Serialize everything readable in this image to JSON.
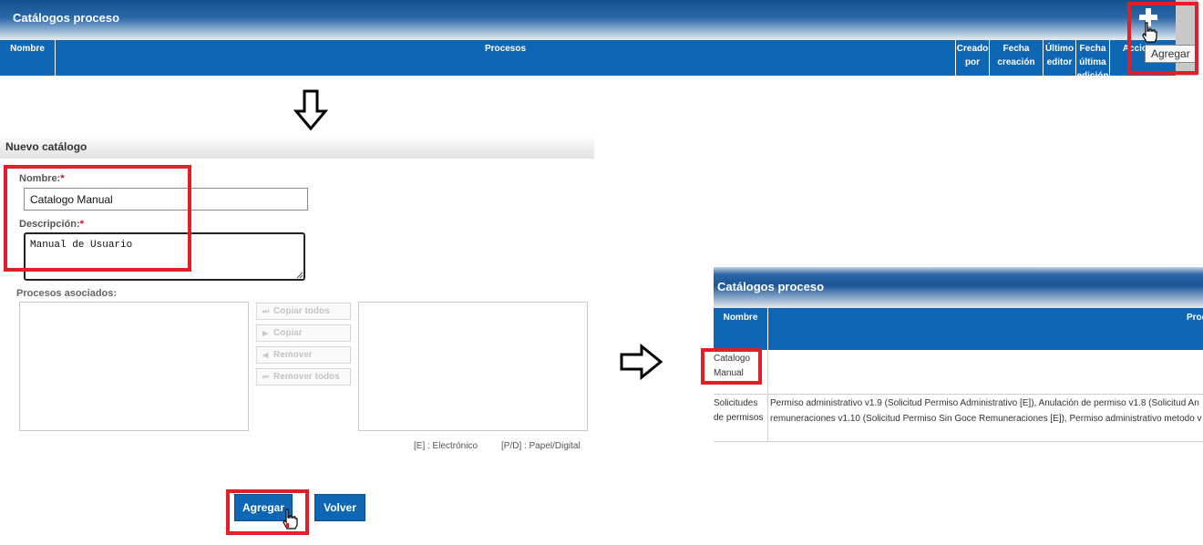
{
  "top_table": {
    "title": "Catálogos proceso",
    "columns": [
      "Nombre",
      "Procesos",
      "Creado por",
      "Fecha creación",
      "Último editor",
      "Fecha última edición",
      "Acciones"
    ],
    "tooltip": "Agregar"
  },
  "form": {
    "title": "Nuevo catálogo",
    "name_label": "Nombre:",
    "name_value": "Catalogo Manual",
    "desc_label": "Descripción:",
    "desc_value": "Manual de Usuario",
    "required_mark": "*",
    "processes_label": "Procesos asociados:",
    "buttons": {
      "copy_all": "Copiar todos",
      "copy": "Copiar",
      "remove": "Remover",
      "remove_all": "Remover todos"
    },
    "legend_e": "[E] : Electrónico",
    "legend_pd": "[P/D] : Papel/Digital",
    "submit": "Agregar",
    "back": "Volver"
  },
  "result_table": {
    "title": "Catálogos proceso",
    "columns": [
      "Nombre",
      "Procesos"
    ],
    "rows": [
      {
        "name_line1": "Catalogo",
        "name_line2": "Manual",
        "processes_line1": "",
        "processes_line2": ""
      },
      {
        "name_line1": "Solicitudes",
        "name_line2": "de permisos",
        "processes_line1": "Permiso administrativo v1.9 (Solicitud Permiso Administrativo [E]), Anulación de permiso v1.8 (Solicitud An",
        "processes_line2": "remuneraciones v1.10 (Solicitud Permiso Sin Goce Remuneraciones [E]), Permiso administrativo metodo v"
      }
    ]
  },
  "colors": {
    "header_blue": "#0f66b4",
    "highlight_red": "#e21f26"
  }
}
